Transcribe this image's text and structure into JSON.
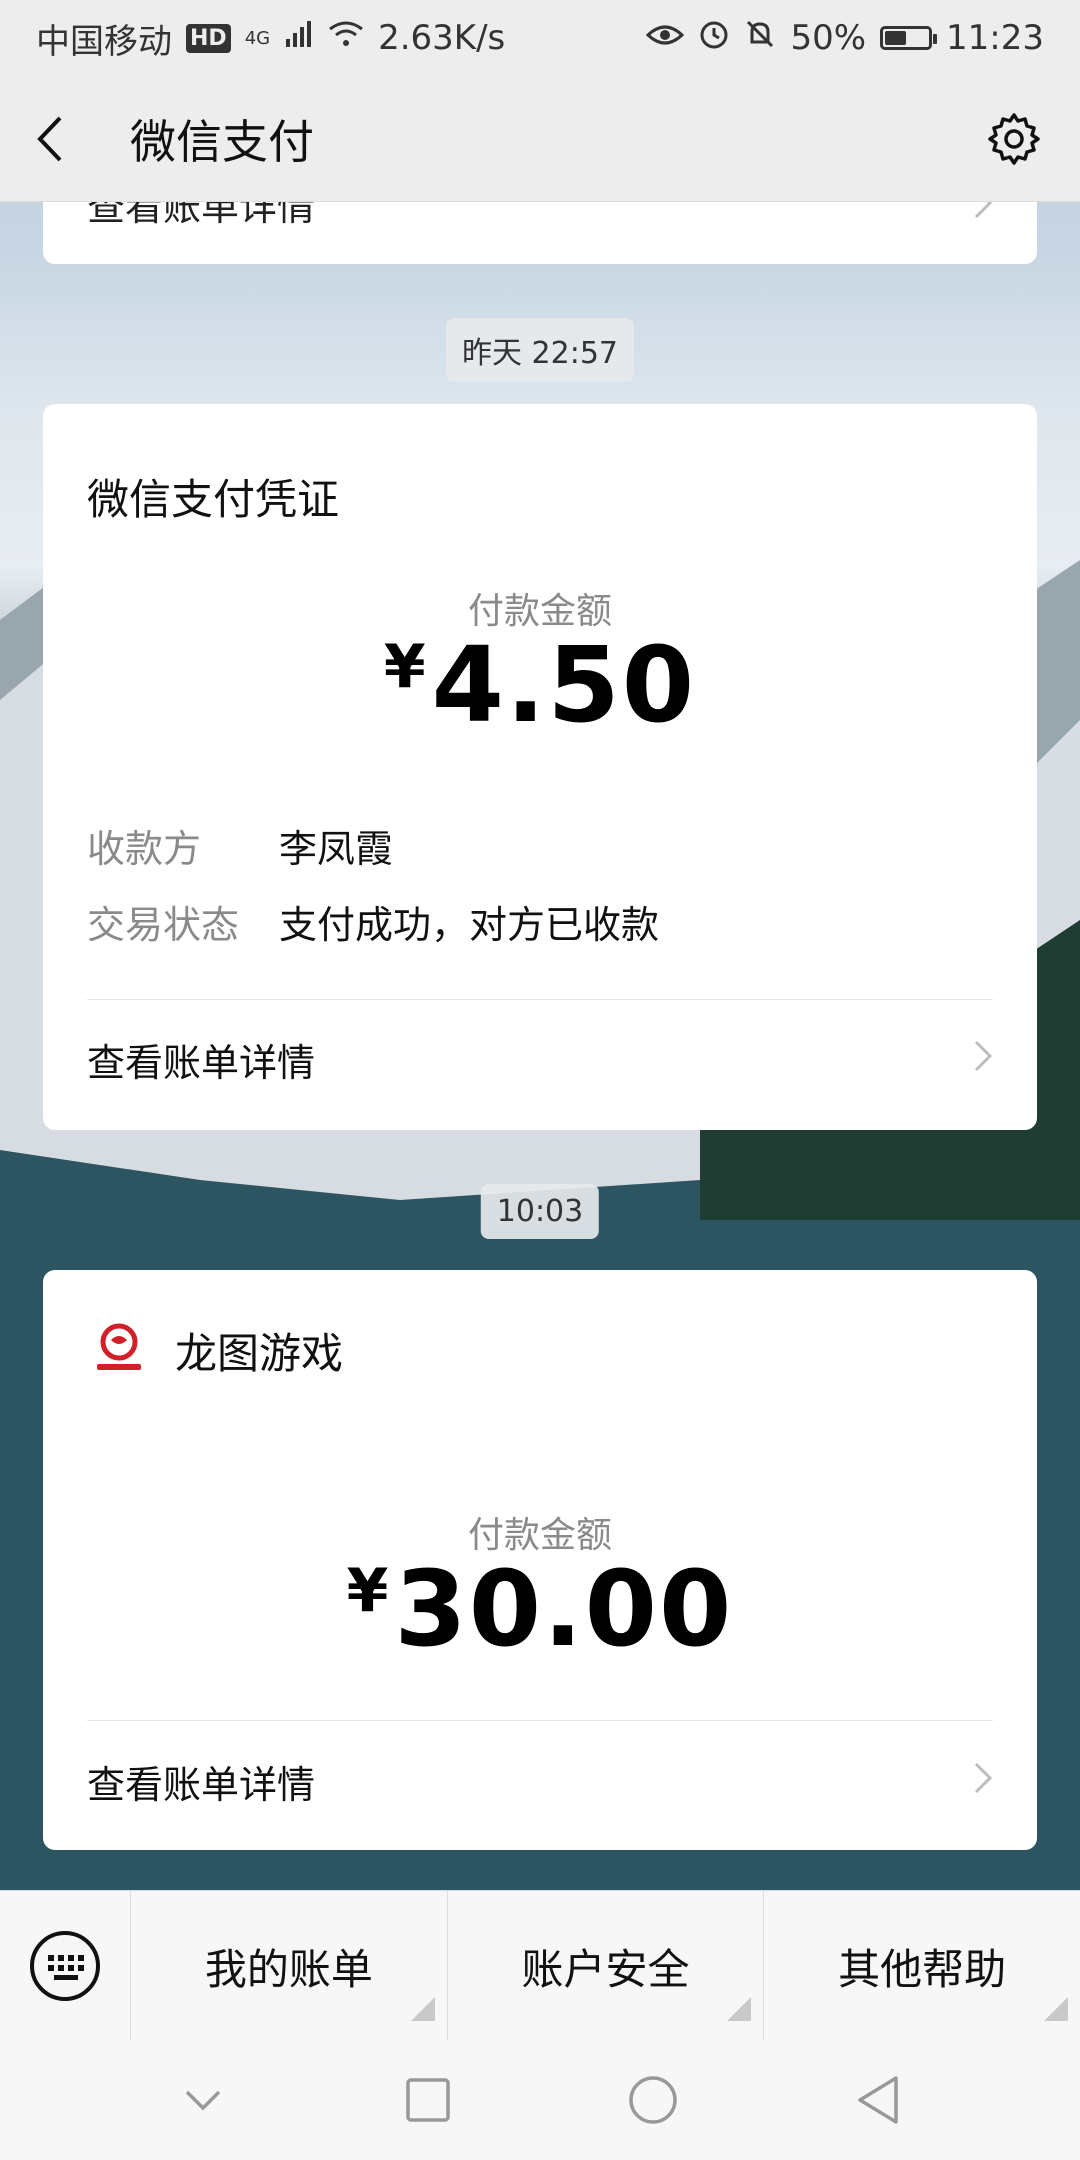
{
  "status_bar": {
    "carrier": "中国移动",
    "hd": "HD",
    "network": "4G",
    "speed": "2.63K/s",
    "battery": "50%",
    "battery_level": 0.5,
    "time": "11:23"
  },
  "header": {
    "title": "微信支付"
  },
  "messages": [
    {
      "detail_label": "查看账单详情"
    },
    {
      "timestamp": "昨天 22:57",
      "title": "微信支付凭证",
      "amount_label": "付款金额",
      "currency": "¥",
      "amount": "4.50",
      "payee_label": "收款方",
      "payee": "李凤霞",
      "status_label": "交易状态",
      "status": "支付成功，对方已收款",
      "detail_label": "查看账单详情"
    },
    {
      "timestamp": "10:03",
      "merchant": "龙图游戏",
      "amount_label": "付款金额",
      "currency": "¥",
      "amount": "30.00",
      "detail_label": "查看账单详情"
    }
  ],
  "bottom_menu": {
    "items": [
      "我的账单",
      "账户安全",
      "其他帮助"
    ]
  },
  "colors": {
    "accent": "#07c160",
    "logo_red": "#d0202a"
  }
}
